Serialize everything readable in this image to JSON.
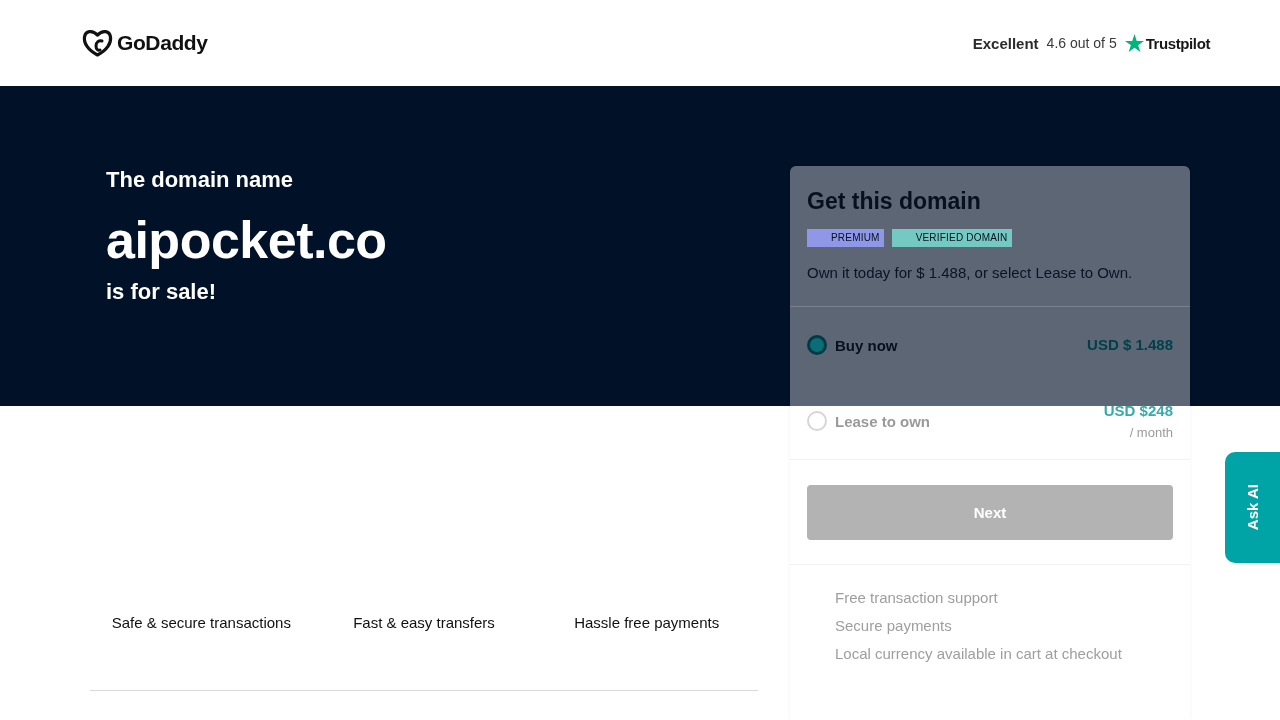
{
  "header": {
    "logo": {
      "text": "GoDaddy"
    },
    "rating": {
      "label": "Excellent",
      "score": "4.6 out of 5",
      "site": "Trustpilot"
    }
  },
  "hero": {
    "intro": "The domain name",
    "domain": "aipocket.co",
    "outro": "is for sale!"
  },
  "features": [
    "Safe & secure transactions",
    "Fast & easy transfers",
    "Hassle free payments"
  ],
  "purchase_card": {
    "title": "Get this domain",
    "badges": [
      {
        "label": "PREMIUM",
        "kind": "premium"
      },
      {
        "label": "VERIFIED DOMAIN",
        "kind": "verified"
      }
    ],
    "description": "Own it today for $ 1.488, or select Lease to Own.",
    "options": [
      {
        "label": "Buy now",
        "price": "USD $ 1.488",
        "selected": true
      },
      {
        "label": "Lease to own",
        "price": "USD $248",
        "period": "/ month",
        "selected": false
      }
    ],
    "button": {
      "label": "Next",
      "disabled": true
    },
    "perks": [
      "Free transaction support",
      "Secure payments",
      "Local currency available in cart at checkout"
    ]
  },
  "ask_ai": {
    "label": "Ask AI"
  }
}
